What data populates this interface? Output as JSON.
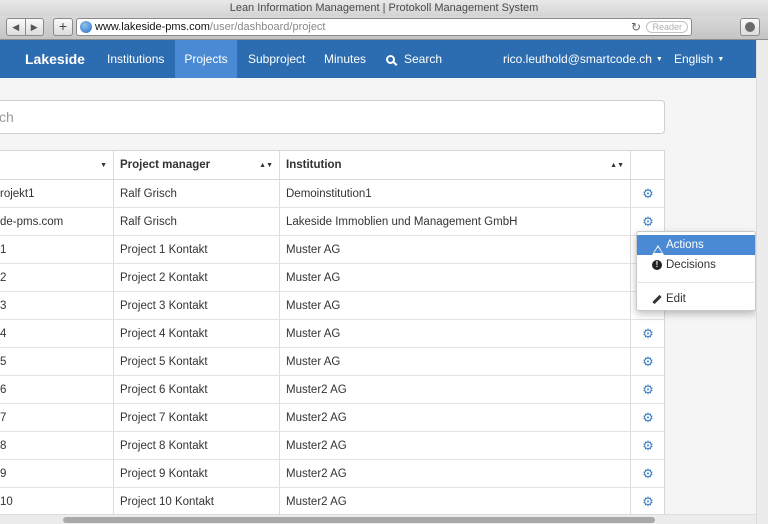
{
  "window": {
    "title": "Lean Information Management | Protokoll Management System"
  },
  "browser": {
    "url_host": "www.lakeside-pms.com",
    "url_path": "/user/dashboard/project",
    "reader_label": "Reader",
    "back_glyph": "◀",
    "forward_glyph": "▶",
    "add_glyph": "+",
    "reload_glyph": "↻"
  },
  "navbar": {
    "brand": "Lakeside",
    "items": [
      "Institutions",
      "Projects",
      "Subproject",
      "Minutes",
      "Search"
    ],
    "active_index": 1,
    "user": "rico.leuthold@smartcode.ch",
    "language": "English",
    "caret": "▼",
    "colors": {
      "bar": "#2c6cb0",
      "active": "#4a8ad4"
    }
  },
  "search": {
    "visible_text": "ch"
  },
  "table": {
    "columns": [
      {
        "label": "",
        "sort": "▼"
      },
      {
        "label": "Project manager",
        "sort": "▲▼"
      },
      {
        "label": "Institution",
        "sort": "▲▼"
      },
      {
        "label": ""
      }
    ],
    "rows": [
      {
        "name": "rojekt1",
        "manager": "Ralf Grisch",
        "institution": "Demoinstitution1",
        "gear": true
      },
      {
        "name": "de-pms.com",
        "manager": "Ralf Grisch",
        "institution": "Lakeside Immoblien und Management GmbH",
        "gear": true
      },
      {
        "name": " 1",
        "manager": "Project 1 Kontakt",
        "institution": "Muster AG",
        "gear": false
      },
      {
        "name": " 2",
        "manager": "Project 2 Kontakt",
        "institution": "Muster AG",
        "gear": false
      },
      {
        "name": " 3",
        "manager": "Project 3 Kontakt",
        "institution": "Muster AG",
        "gear": false
      },
      {
        "name": " 4",
        "manager": "Project 4 Kontakt",
        "institution": "Muster AG",
        "gear": true
      },
      {
        "name": " 5",
        "manager": "Project 5 Kontakt",
        "institution": "Muster AG",
        "gear": true
      },
      {
        "name": " 6",
        "manager": "Project 6 Kontakt",
        "institution": "Muster2 AG",
        "gear": true
      },
      {
        "name": " 7",
        "manager": "Project 7 Kontakt",
        "institution": "Muster2 AG",
        "gear": true
      },
      {
        "name": " 8",
        "manager": "Project 8 Kontakt",
        "institution": "Muster2 AG",
        "gear": true
      },
      {
        "name": " 9",
        "manager": "Project 9 Kontakt",
        "institution": "Muster2 AG",
        "gear": true
      },
      {
        "name": " 10",
        "manager": "Project 10 Kontakt",
        "institution": "Muster2 AG",
        "gear": true
      }
    ],
    "gear_glyph": "⚙",
    "gear_color": "#3f7cc4"
  },
  "dropdown": {
    "items": [
      {
        "label": "Actions",
        "icon": "warning-icon",
        "highlighted": true
      },
      {
        "label": "Decisions",
        "icon": "exclamation-icon",
        "highlighted": false
      },
      {
        "label": "Edit",
        "icon": "pencil-icon",
        "highlighted": false
      }
    ]
  }
}
